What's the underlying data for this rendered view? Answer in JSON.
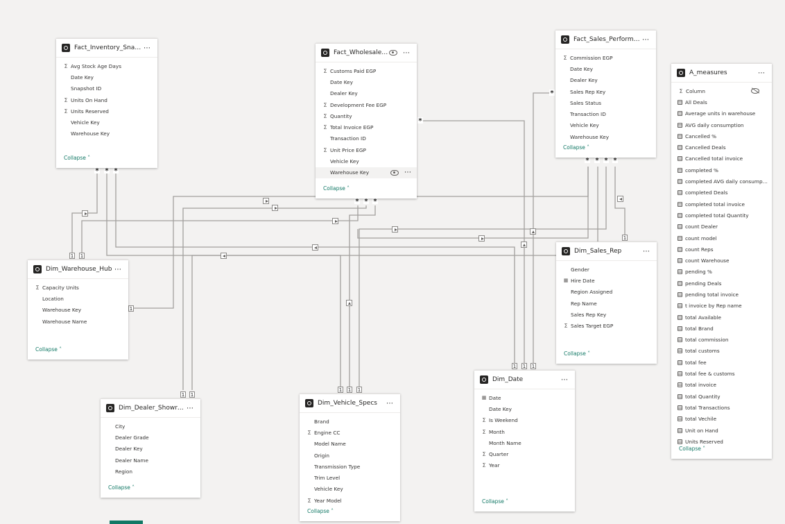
{
  "tables": {
    "inv": {
      "title": "Fact_Inventory_Snapshot",
      "collapse": "Collapse",
      "fields": [
        {
          "name": "Avg Stock Age Days",
          "icon": "sigma"
        },
        {
          "name": "Date Key",
          "icon": ""
        },
        {
          "name": "Snapshot ID",
          "icon": ""
        },
        {
          "name": "Units On Hand",
          "icon": "sigma"
        },
        {
          "name": "Units Reserved",
          "icon": "sigma"
        },
        {
          "name": "Vehicle Key",
          "icon": ""
        },
        {
          "name": "Warehouse Key",
          "icon": ""
        }
      ]
    },
    "wholesale": {
      "title": "Fact_Wholesale_Dis...",
      "collapse": "Collapse",
      "fields": [
        {
          "name": "Customs Paid EGP",
          "icon": "sigma"
        },
        {
          "name": "Date Key",
          "icon": ""
        },
        {
          "name": "Dealer Key",
          "icon": ""
        },
        {
          "name": "Development Fee EGP",
          "icon": "sigma"
        },
        {
          "name": "Quantity",
          "icon": "sigma"
        },
        {
          "name": "Total Invoice EGP",
          "icon": "sigma"
        },
        {
          "name": "Transaction ID",
          "icon": ""
        },
        {
          "name": "Unit Price EGP",
          "icon": "sigma"
        },
        {
          "name": "Vehicle Key",
          "icon": ""
        },
        {
          "name": "Warehouse Key",
          "icon": "",
          "hl": true
        }
      ]
    },
    "sales": {
      "title": "Fact_Sales_Performance...",
      "collapse": "Collapse",
      "fields": [
        {
          "name": "Commission EGP",
          "icon": "sigma"
        },
        {
          "name": "Date Key",
          "icon": ""
        },
        {
          "name": "Dealer Key",
          "icon": ""
        },
        {
          "name": "Sales Rep Key",
          "icon": ""
        },
        {
          "name": "Sales Status",
          "icon": ""
        },
        {
          "name": "Transaction ID",
          "icon": ""
        },
        {
          "name": "Vehicle Key",
          "icon": ""
        },
        {
          "name": "Warehouse Key",
          "icon": ""
        }
      ]
    },
    "measures": {
      "title": "A_measures",
      "collapse": "Collapse",
      "fields": [
        {
          "name": "Column",
          "icon": "sigma"
        },
        {
          "name": "All Deals",
          "icon": "calc"
        },
        {
          "name": "Average units in warehouse",
          "icon": "calc"
        },
        {
          "name": "AVG daily consumption",
          "icon": "calc"
        },
        {
          "name": "Cancelled %",
          "icon": "calc"
        },
        {
          "name": "Cancelled Deals",
          "icon": "calc"
        },
        {
          "name": "Cancelled total invoice",
          "icon": "calc"
        },
        {
          "name": "completed %",
          "icon": "calc"
        },
        {
          "name": "completed AVG daily consumption...",
          "icon": "calc"
        },
        {
          "name": "completed Deals",
          "icon": "calc"
        },
        {
          "name": "completed total invoice",
          "icon": "calc"
        },
        {
          "name": "completed total Quantity",
          "icon": "calc"
        },
        {
          "name": "count Dealer",
          "icon": "calc"
        },
        {
          "name": "count model",
          "icon": "calc"
        },
        {
          "name": "count Reps",
          "icon": "calc"
        },
        {
          "name": "count Warehouse",
          "icon": "calc"
        },
        {
          "name": "pending %",
          "icon": "calc"
        },
        {
          "name": "pending Deals",
          "icon": "calc"
        },
        {
          "name": "pending total invoice",
          "icon": "calc"
        },
        {
          "name": "t invoice by Rep name",
          "icon": "calc"
        },
        {
          "name": "total Available",
          "icon": "calc"
        },
        {
          "name": "total Brand",
          "icon": "calc"
        },
        {
          "name": "total commission",
          "icon": "calc"
        },
        {
          "name": "total customs",
          "icon": "calc"
        },
        {
          "name": "total fee",
          "icon": "calc"
        },
        {
          "name": "total fee & customs",
          "icon": "calc"
        },
        {
          "name": "total invoice",
          "icon": "calc"
        },
        {
          "name": "total Quantity",
          "icon": "calc"
        },
        {
          "name": "total Transactions",
          "icon": "calc"
        },
        {
          "name": "total Vechile",
          "icon": "calc"
        },
        {
          "name": "Unit on Hand",
          "icon": "calc"
        },
        {
          "name": "Units Reserved",
          "icon": "calc"
        }
      ]
    },
    "warehouse": {
      "title": "Dim_Warehouse_Hub",
      "collapse": "Collapse",
      "fields": [
        {
          "name": "Capacity Units",
          "icon": "sigma"
        },
        {
          "name": "Location",
          "icon": ""
        },
        {
          "name": "Warehouse Key",
          "icon": ""
        },
        {
          "name": "Warehouse Name",
          "icon": ""
        }
      ]
    },
    "salesrep": {
      "title": "Dim_Sales_Rep",
      "collapse": "Collapse",
      "fields": [
        {
          "name": "Gender",
          "icon": ""
        },
        {
          "name": "Hire Date",
          "icon": "cal"
        },
        {
          "name": "Region Assigned",
          "icon": ""
        },
        {
          "name": "Rep Name",
          "icon": ""
        },
        {
          "name": "Sales Rep Key",
          "icon": ""
        },
        {
          "name": "Sales Target EGP",
          "icon": "sigma"
        }
      ]
    },
    "dealer": {
      "title": "Dim_Dealer_Showroom",
      "collapse": "Collapse",
      "fields": [
        {
          "name": "City",
          "icon": ""
        },
        {
          "name": "Dealer Grade",
          "icon": ""
        },
        {
          "name": "Dealer Key",
          "icon": ""
        },
        {
          "name": "Dealer Name",
          "icon": ""
        },
        {
          "name": "Region",
          "icon": ""
        }
      ]
    },
    "vehicle": {
      "title": "Dim_Vehicle_Specs",
      "collapse": "Collapse",
      "fields": [
        {
          "name": "Brand",
          "icon": ""
        },
        {
          "name": "Engine CC",
          "icon": "sigma"
        },
        {
          "name": "Model Name",
          "icon": ""
        },
        {
          "name": "Origin",
          "icon": ""
        },
        {
          "name": "Transmission Type",
          "icon": ""
        },
        {
          "name": "Trim Level",
          "icon": ""
        },
        {
          "name": "Vehicle Key",
          "icon": ""
        },
        {
          "name": "Year Model",
          "icon": "sigma"
        }
      ]
    },
    "date": {
      "title": "Dim_Date",
      "collapse": "Collapse",
      "fields": [
        {
          "name": "Date",
          "icon": "cal"
        },
        {
          "name": "Date Key",
          "icon": ""
        },
        {
          "name": "Is Weekend",
          "icon": "sigma"
        },
        {
          "name": "Month",
          "icon": "sigma"
        },
        {
          "name": "Month Name",
          "icon": ""
        },
        {
          "name": "Quarter",
          "icon": "sigma"
        },
        {
          "name": "Year",
          "icon": "sigma"
        }
      ]
    }
  },
  "cardinality": {
    "many": "*",
    "one": "1"
  }
}
